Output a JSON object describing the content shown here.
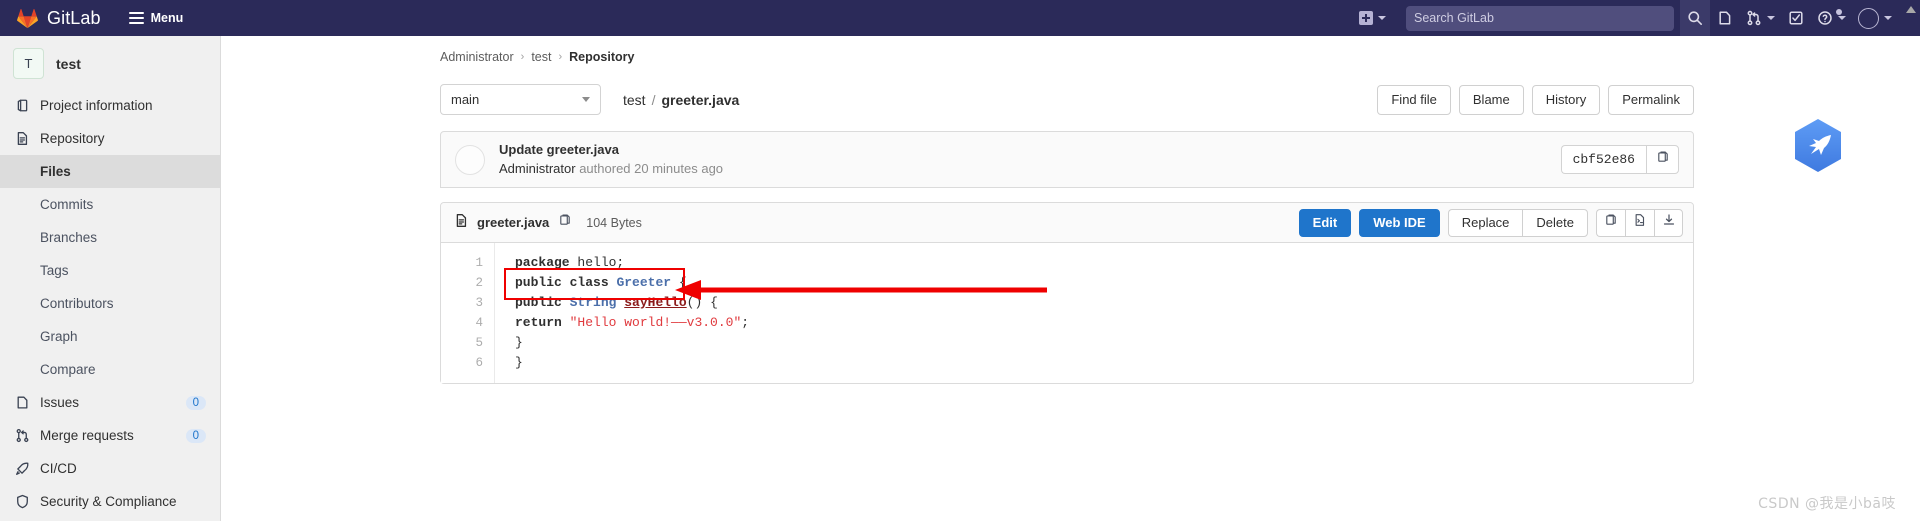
{
  "navbar": {
    "brand": "GitLab",
    "menu_label": "Menu",
    "brand_color": "#2b2a59",
    "logo_icon": "gitlab-tanuki-icon",
    "hamburger_icon": "hamburger-icon",
    "create_new_icon": "plus-square-icon",
    "search": {
      "placeholder": "Search GitLab",
      "value": "",
      "icon": "search-icon"
    },
    "right_icons": [
      {
        "name": "search-icon",
        "label": "Search"
      },
      {
        "name": "issues-icon",
        "label": "Issues"
      },
      {
        "name": "merge-requests-icon",
        "label": "Merge requests"
      },
      {
        "name": "todos-icon",
        "label": "To-Do List"
      },
      {
        "name": "help-icon",
        "label": "Help"
      },
      {
        "name": "user-avatar-icon",
        "label": "User menu"
      }
    ]
  },
  "sidebar": {
    "project": {
      "initial": "T",
      "name": "test"
    },
    "items": [
      {
        "label": "Project information",
        "icon": "information-icon",
        "level": "top",
        "badge": ""
      },
      {
        "label": "Repository",
        "icon": "doc-text-icon",
        "level": "top",
        "badge": ""
      },
      {
        "label": "Files",
        "icon": "",
        "level": "sub",
        "badge": "",
        "selected": true
      },
      {
        "label": "Commits",
        "icon": "",
        "level": "sub",
        "badge": ""
      },
      {
        "label": "Branches",
        "icon": "",
        "level": "sub",
        "badge": ""
      },
      {
        "label": "Tags",
        "icon": "",
        "level": "sub",
        "badge": ""
      },
      {
        "label": "Contributors",
        "icon": "",
        "level": "sub",
        "badge": ""
      },
      {
        "label": "Graph",
        "icon": "",
        "level": "sub",
        "badge": ""
      },
      {
        "label": "Compare",
        "icon": "",
        "level": "sub",
        "badge": ""
      },
      {
        "label": "Issues",
        "icon": "issues-icon",
        "level": "top",
        "badge": "0"
      },
      {
        "label": "Merge requests",
        "icon": "merge-requests-icon",
        "level": "top",
        "badge": "0"
      },
      {
        "label": "CI/CD",
        "icon": "rocket-icon",
        "level": "top",
        "badge": ""
      },
      {
        "label": "Security & Compliance",
        "icon": "shield-icon",
        "level": "top",
        "badge": ""
      }
    ]
  },
  "breadcrumb": {
    "items": [
      "Administrator",
      "test"
    ],
    "current": "Repository",
    "separator": "›"
  },
  "file_bar": {
    "branch": "main",
    "path_root": "test",
    "path_sep": "/",
    "path_file": "greeter.java",
    "actions": [
      "Find file",
      "Blame",
      "History",
      "Permalink"
    ]
  },
  "commit": {
    "title": "Update greeter.java",
    "author": "Administrator",
    "meta": "authored 20 minutes ago",
    "sha": "cbf52e86",
    "copy_icon": "copy-icon",
    "avatar_icon": "avatar"
  },
  "file_header": {
    "file_icon": "doc-text-icon",
    "name": "greeter.java",
    "copy_path_icon": "copy-icon",
    "size": "104 Bytes",
    "primary_buttons": [
      "Edit",
      "Web IDE"
    ],
    "secondary_buttons": [
      "Replace",
      "Delete"
    ],
    "icon_buttons": [
      "copy-icon",
      "open-raw-icon",
      "download-icon"
    ]
  },
  "code": {
    "line_numbers": [
      "1",
      "2",
      "3",
      "4",
      "5",
      "6"
    ],
    "lines": [
      [
        {
          "t": "package",
          "c": "kw"
        },
        {
          "t": " hello;",
          "c": "pln"
        }
      ],
      [
        {
          "t": "public class",
          "c": "kw"
        },
        {
          "t": " ",
          "c": "pln"
        },
        {
          "t": "Greeter",
          "c": "typ"
        },
        {
          "t": " {",
          "c": "pln"
        }
      ],
      [
        {
          "t": "public",
          "c": "kw"
        },
        {
          "t": " ",
          "c": "pln"
        },
        {
          "t": "String",
          "c": "typ"
        },
        {
          "t": " ",
          "c": "pln"
        },
        {
          "t": "sayHello",
          "c": "fn"
        },
        {
          "t": "() {",
          "c": "pln"
        }
      ],
      [
        {
          "t": "return",
          "c": "kw"
        },
        {
          "t": " ",
          "c": "pln"
        },
        {
          "t": "\"Hello world!——v3.0.0\"",
          "c": "str"
        },
        {
          "t": ";",
          "c": "pln"
        }
      ],
      [
        {
          "t": "}",
          "c": "pln"
        }
      ],
      [
        {
          "t": "}",
          "c": "pln"
        }
      ]
    ]
  },
  "annotation": {
    "highlight_color": "#ef0000",
    "target_line": "4",
    "shape": "rectangle-with-arrow"
  },
  "float_logo": {
    "icon": "hexagon-bird-icon",
    "color": "#4a8cf0"
  },
  "watermark": {
    "text": "CSDN @我是小bā吱"
  },
  "colors": {
    "nav_bg": "#2b2a59",
    "sidebar_bg": "#f0f0f0",
    "primary_button": "#1f75cb",
    "badge_bg": "#dbe7f7",
    "badge_text": "#1f75cb",
    "string_red": "#e03a3e"
  }
}
